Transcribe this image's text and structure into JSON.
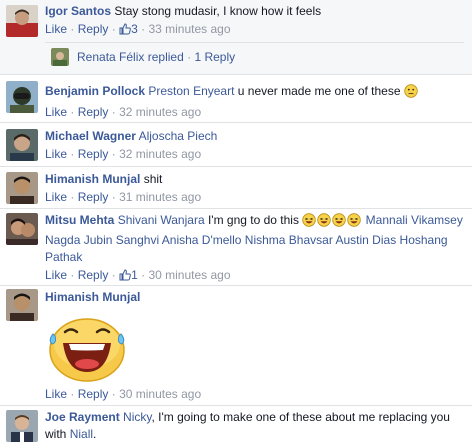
{
  "comments": [
    {
      "name": "Igor Santos",
      "text": "Stay stong mudasir, I know how it feels",
      "actions": {
        "like": "Like",
        "reply": "Reply",
        "likes": "3",
        "time": "33 minutes ago"
      },
      "reply_summary": {
        "name": "Renata Félix",
        "replied": "replied",
        "count": "1 Reply"
      }
    },
    {
      "name": "Benjamin Pollock",
      "tags": [
        "Preston Enyeart"
      ],
      "text": "u never made me one of these",
      "emoji": "confused-face",
      "actions": {
        "like": "Like",
        "reply": "Reply",
        "time": "32 minutes ago"
      }
    },
    {
      "name": "Michael Wagner",
      "tags": [
        "Aljoscha Piech"
      ],
      "actions": {
        "like": "Like",
        "reply": "Reply",
        "time": "32 minutes ago"
      }
    },
    {
      "name": "Himanish Munjal",
      "text": "shit",
      "actions": {
        "like": "Like",
        "reply": "Reply",
        "time": "31 minutes ago"
      }
    },
    {
      "name": "Mitsu Mehta",
      "tags": [
        "Shivani Wanjara",
        "Mannali Vikamsey Nagda",
        "Jubin Sanghvi",
        "Anisha D'mello",
        "Nishma Bhavsar",
        "Austin Dias",
        "Hoshang Pathak"
      ],
      "text": "I'm gng to do this",
      "emoji": "laughing-face",
      "actions": {
        "like": "Like",
        "reply": "Reply",
        "likes": "1",
        "time": "30 minutes ago"
      }
    },
    {
      "name": "Himanish Munjal",
      "sticker": "tears-of-joy-sticker",
      "actions": {
        "like": "Like",
        "reply": "Reply",
        "time": "30 minutes ago"
      }
    },
    {
      "name": "Joe Rayment",
      "tags": [
        "Nicky",
        "Niall"
      ],
      "text": "I'm going to make one of these about me replacing you with",
      "text_end": "."
    }
  ],
  "colors": {
    "link": "#3b5998",
    "meta": "#9197a3",
    "text": "#141823",
    "shade": "#f6f7f9",
    "divider": "#e1e2e3"
  }
}
